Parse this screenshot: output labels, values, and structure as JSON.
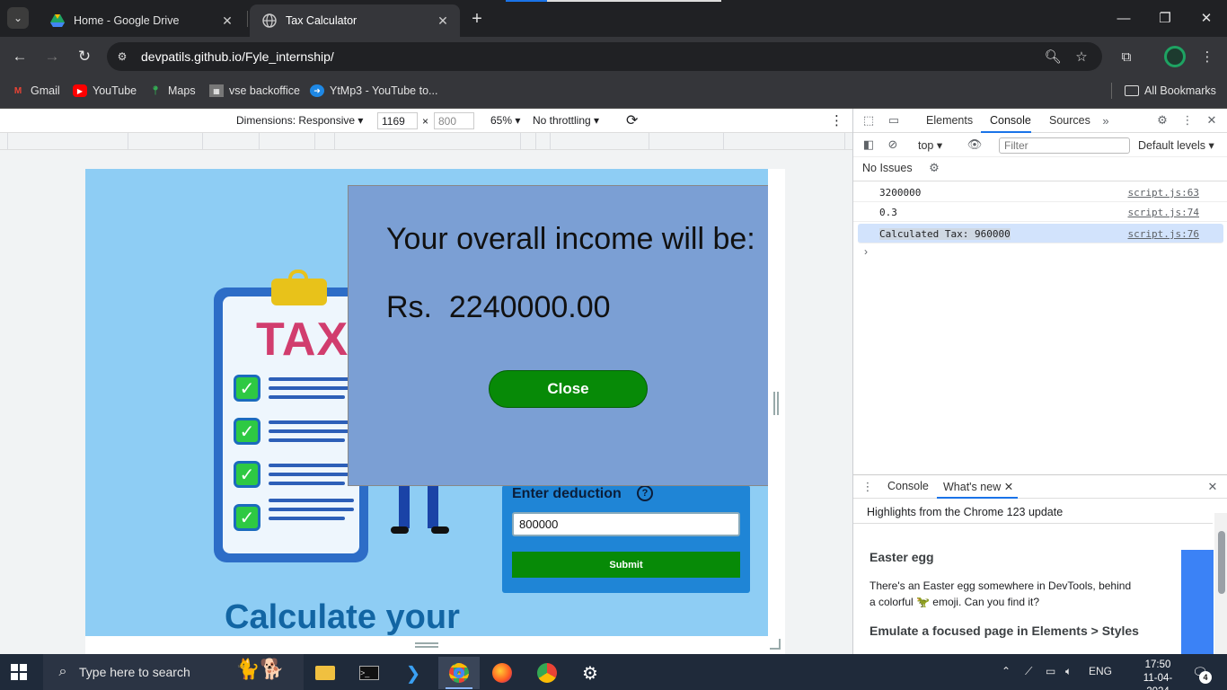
{
  "browser": {
    "tabs": [
      {
        "title": "Home - Google Drive",
        "icon": "google-drive-icon"
      },
      {
        "title": "Tax Calculator",
        "icon": "globe-icon"
      }
    ],
    "url_host": "devpatils.github.io",
    "url_path": "/Fyle_internship/",
    "bookmarks": [
      {
        "label": "Gmail",
        "icon": "gmail-icon"
      },
      {
        "label": "YouTube",
        "icon": "youtube-icon"
      },
      {
        "label": "Maps",
        "icon": "maps-icon"
      },
      {
        "label": "vse backoffice",
        "icon": "vse-icon"
      },
      {
        "label": "YtMp3 - YouTube to...",
        "icon": "ytmp3-icon"
      }
    ],
    "all_bookmarks": "All Bookmarks"
  },
  "device_toolbar": {
    "dimensions": "Dimensions: Responsive",
    "width": "1169",
    "times": "×",
    "height": "800",
    "zoom": "65%",
    "throttling": "No throttling"
  },
  "page": {
    "tax_word": "TAX",
    "modal": {
      "heading": "Your overall income will be:",
      "amount": "Rs.  2240000.00",
      "close_label": "Close"
    },
    "form": {
      "label": "Enter deduction",
      "help": "?",
      "value": "800000",
      "submit_label": "Submit"
    },
    "heading": "Calculate your"
  },
  "devtools": {
    "tabs": [
      "Elements",
      "Console",
      "Sources"
    ],
    "context": "top",
    "filter_placeholder": "Filter",
    "levels": "Default levels",
    "issues": "No Issues",
    "console_lines": [
      {
        "msg": "3200000",
        "src": "script.js:63"
      },
      {
        "msg": "0.3",
        "src": "script.js:74"
      },
      {
        "msg": "Calculated Tax: 960000",
        "src": "script.js:76"
      }
    ],
    "drawer_tabs": [
      "Console",
      "What's new"
    ],
    "highlights": "Highlights from the Chrome 123 update",
    "whatsnew": {
      "item1_title": "Easter egg",
      "item1_text": "There's an Easter egg somewhere in DevTools, behind a colorful 🦖 emoji. Can you find it?",
      "item2_title": "Emulate a focused page in Elements > Styles"
    }
  },
  "taskbar": {
    "search_placeholder": "Type here to search",
    "lang": "ENG",
    "time": "17:50",
    "date": "11-04-2024",
    "notif_count": "4"
  }
}
